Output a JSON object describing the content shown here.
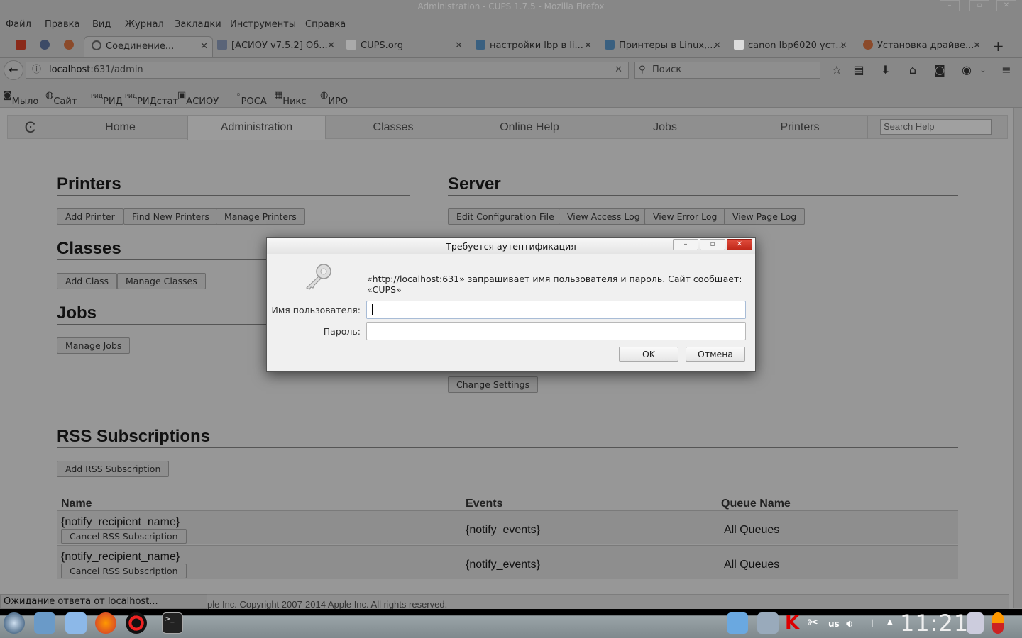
{
  "window": {
    "title": "Administration - CUPS 1.7.5 - Mozilla Firefox"
  },
  "menu": [
    "Файл",
    "Правка",
    "Вид",
    "Журнал",
    "Закладки",
    "Инструменты",
    "Справка"
  ],
  "tabs": [
    {
      "label": "Соединение...",
      "active": true
    },
    {
      "label": "[АСИОУ v7.5.2] Об..."
    },
    {
      "label": "CUPS.org"
    },
    {
      "label": "настройки lbp в li..."
    },
    {
      "label": "Принтеры в Linux,..."
    },
    {
      "label": "canon lbp6020 уст..."
    },
    {
      "label": "Установка драйве..."
    }
  ],
  "address": {
    "host": "localhost",
    "path": ":631/admin"
  },
  "search": {
    "placeholder": "Поиск"
  },
  "bookmarks": [
    "Мыло",
    "Сайт",
    "РИД",
    "РИДстат",
    "АСИОУ",
    "РОСА",
    "Никс",
    "ИРО"
  ],
  "cups": {
    "nav": [
      "Home",
      "Administration",
      "Classes",
      "Online Help",
      "Jobs",
      "Printers"
    ],
    "search_placeholder": "Search Help",
    "printers": {
      "title": "Printers",
      "buttons": [
        "Add Printer",
        "Find New Printers",
        "Manage Printers"
      ]
    },
    "server": {
      "title": "Server",
      "buttons": [
        "Edit Configuration File",
        "View Access Log",
        "View Error Log",
        "View Page Log"
      ],
      "change_settings": "Change Settings"
    },
    "classes": {
      "title": "Classes",
      "buttons": [
        "Add Class",
        "Manage Classes"
      ]
    },
    "jobs": {
      "title": "Jobs",
      "buttons": [
        "Manage Jobs"
      ]
    },
    "rss": {
      "title": "RSS Subscriptions",
      "add": "Add RSS Subscription",
      "columns": [
        "Name",
        "Events",
        "Queue Name"
      ],
      "rows": [
        {
          "name": "{notify_recipient_name}",
          "cancel": "Cancel RSS Subscription",
          "events": "{notify_events}",
          "queue": "All Queues"
        },
        {
          "name": "{notify_recipient_name}",
          "cancel": "Cancel RSS Subscription",
          "events": "{notify_events}",
          "queue": "All Queues"
        }
      ]
    },
    "copyright": "ple Inc. Copyright 2007-2014 Apple Inc. All rights reserved."
  },
  "status": "Ожидание ответа от localhost...",
  "dialog": {
    "title": "Требуется аутентификация",
    "message": "«http://localhost:631» запрашивает имя пользователя и пароль. Сайт сообщает: «CUPS»",
    "username_label": "Имя пользователя:",
    "password_label": "Пароль:",
    "username": "",
    "password": "",
    "ok": "OK",
    "cancel": "Отмена"
  },
  "taskbar": {
    "layout": "us",
    "clock": "11:21"
  }
}
